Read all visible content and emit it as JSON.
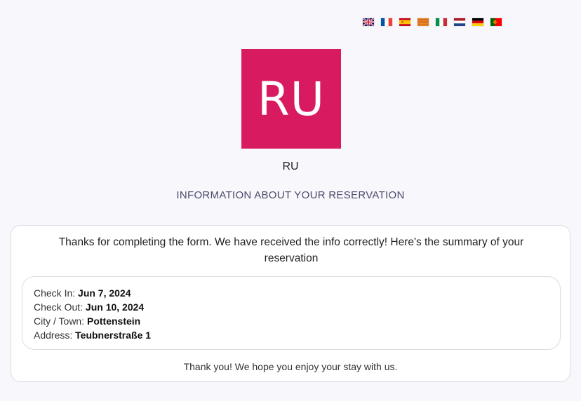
{
  "languages": [
    {
      "code": "en",
      "icon": "flag-uk-icon"
    },
    {
      "code": "fr",
      "icon": "flag-france-icon"
    },
    {
      "code": "es",
      "icon": "flag-spain-icon"
    },
    {
      "code": "ca",
      "icon": "flag-catalonia-icon"
    },
    {
      "code": "it",
      "icon": "flag-italy-icon"
    },
    {
      "code": "nl",
      "icon": "flag-netherlands-icon"
    },
    {
      "code": "de",
      "icon": "flag-germany-icon"
    },
    {
      "code": "pt",
      "icon": "flag-portugal-icon"
    }
  ],
  "logo": {
    "text": "RU",
    "background_color": "#d81b60"
  },
  "hotel_name": "RU",
  "section_title": "INFORMATION ABOUT YOUR RESERVATION",
  "confirmation_message": "Thanks for completing the form. We have received the info correctly! Here's the summary of your reservation",
  "summary": {
    "check_in_label": "Check In:",
    "check_in_value": "Jun 7, 2024",
    "check_out_label": "Check Out:",
    "check_out_value": "Jun 10, 2024",
    "city_label": "City / Town:",
    "city_value": "Pottenstein",
    "address_label": "Address:",
    "address_value": "Teubnerstraße 1"
  },
  "footer_message": "Thank you! We hope you enjoy your stay with us."
}
